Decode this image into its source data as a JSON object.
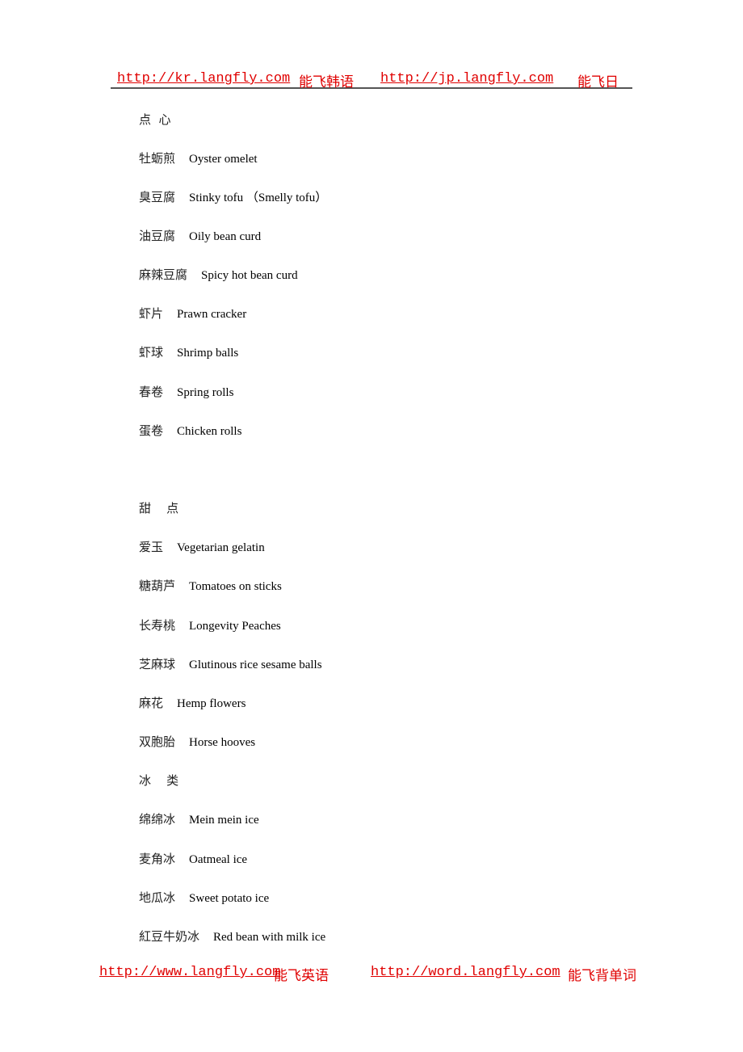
{
  "header": {
    "link1": "http://kr.langfly.com",
    "text1": "能飞韩语",
    "link2": "http://jp.langfly.com",
    "text2": "能飞日"
  },
  "sections": [
    {
      "title": "点  心",
      "items": [
        {
          "cn": "牡蛎煎",
          "en": "Oyster omelet"
        },
        {
          "cn": "臭豆腐",
          "en": "Stinky tofu （Smelly tofu）"
        },
        {
          "cn": "油豆腐",
          "en": "Oily bean curd"
        },
        {
          "cn": "麻辣豆腐",
          "en": "Spicy hot bean curd"
        },
        {
          "cn": "虾片",
          "en": "Prawn cracker"
        },
        {
          "cn": "虾球",
          "en": "Shrimp balls"
        },
        {
          "cn": "春卷",
          "en": "Spring rolls"
        },
        {
          "cn": "蛋卷",
          "en": "Chicken rolls"
        }
      ]
    },
    {
      "title": "甜    点",
      "items": [
        {
          "cn": "爱玉",
          "en": "Vegetarian gelatin"
        },
        {
          "cn": "糖葫芦",
          "en": "Tomatoes on sticks"
        },
        {
          "cn": "长寿桃",
          "en": "Longevity Peaches"
        },
        {
          "cn": "芝麻球",
          "en": "Glutinous rice sesame balls"
        },
        {
          "cn": "麻花",
          "en": "Hemp flowers"
        },
        {
          "cn": "双胞胎",
          "en": "Horse hooves"
        }
      ]
    },
    {
      "title": "冰    类",
      "items": [
        {
          "cn": "绵绵冰",
          "en": "Mein mein ice"
        },
        {
          "cn": "麦角冰",
          "en": "Oatmeal ice"
        },
        {
          "cn": "地瓜冰",
          "en": "Sweet potato ice"
        },
        {
          "cn": "紅豆牛奶冰",
          "en": "Red bean with milk ice"
        }
      ]
    }
  ],
  "footer": {
    "link1": "http://www.langfly.com",
    "text1": "能飞英语",
    "link2": "http://word.langfly.com",
    "text2": "能飞背单词"
  }
}
